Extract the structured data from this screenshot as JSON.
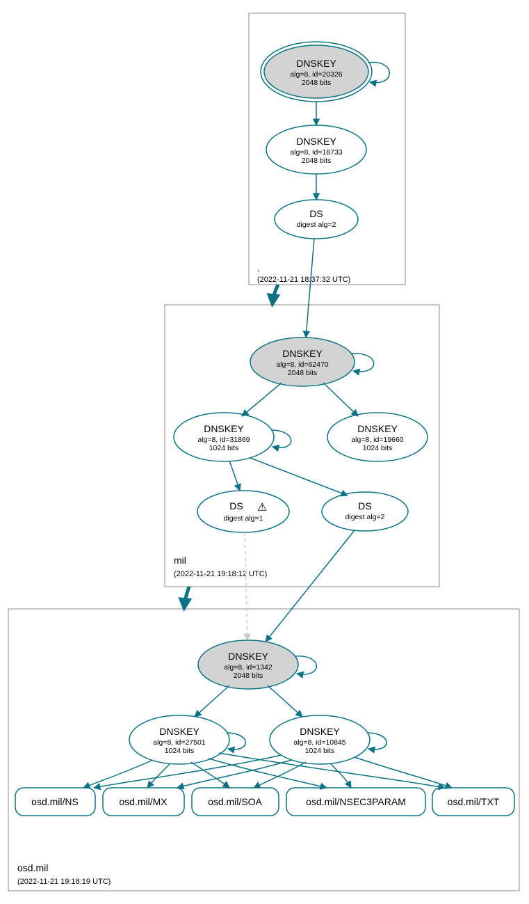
{
  "colors": {
    "teal": "#0b7285",
    "grey": "#d3d3d3"
  },
  "zones": {
    "root": {
      "label": ".",
      "timestamp": "(2022-11-21 18:37:32 UTC)",
      "ksk": {
        "title": "DNSKEY",
        "sub1": "alg=8, id=20326",
        "sub2": "2048 bits"
      },
      "zsk": {
        "title": "DNSKEY",
        "sub1": "alg=8, id=18733",
        "sub2": "2048 bits"
      },
      "ds": {
        "title": "DS",
        "sub1": "digest alg=2"
      }
    },
    "mil": {
      "label": "mil",
      "timestamp": "(2022-11-21 19:18:12 UTC)",
      "ksk": {
        "title": "DNSKEY",
        "sub1": "alg=8, id=62470",
        "sub2": "2048 bits"
      },
      "zsk1": {
        "title": "DNSKEY",
        "sub1": "alg=8, id=31869",
        "sub2": "1024 bits"
      },
      "zsk2": {
        "title": "DNSKEY",
        "sub1": "alg=8, id=19660",
        "sub2": "1024 bits"
      },
      "ds1": {
        "title": "DS",
        "sub1": "digest alg=1",
        "warn": "⚠"
      },
      "ds2": {
        "title": "DS",
        "sub1": "digest alg=2"
      }
    },
    "osd": {
      "label": "osd.mil",
      "timestamp": "(2022-11-21 19:18:19 UTC)",
      "ksk": {
        "title": "DNSKEY",
        "sub1": "alg=8, id=1342",
        "sub2": "2048 bits"
      },
      "zsk1": {
        "title": "DNSKEY",
        "sub1": "alg=8, id=27501",
        "sub2": "1024 bits"
      },
      "zsk2": {
        "title": "DNSKEY",
        "sub1": "alg=8, id=10845",
        "sub2": "1024 bits"
      },
      "rr": {
        "ns": "osd.mil/NS",
        "mx": "osd.mil/MX",
        "soa": "osd.mil/SOA",
        "nsec3param": "osd.mil/NSEC3PARAM",
        "txt": "osd.mil/TXT"
      }
    }
  }
}
